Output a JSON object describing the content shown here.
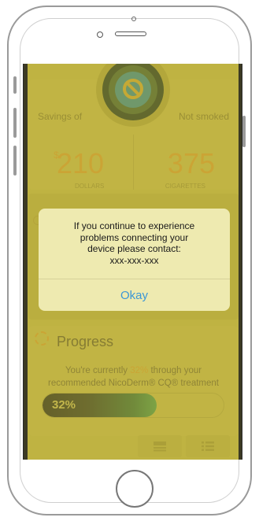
{
  "stats": {
    "savings_label": "Savings of",
    "not_smoked_label": "Not smoked",
    "currency_symbol": "$",
    "dollars_value": "210",
    "dollars_unit": "DOLLARS",
    "cigarettes_value": "375",
    "cigarettes_unit": "CIGARETTES"
  },
  "alert": {
    "line1": "If you continue to experience",
    "line2": "problems connecting your",
    "line3": "device please contact:",
    "line4": "xxx-xxx-xxx",
    "button_label": "Okay"
  },
  "progress": {
    "title": "Progress",
    "desc_prefix": "You're currently ",
    "percent_text": "32%",
    "desc_suffix_line1": " through your",
    "desc_line2": "recommended NicoDerm® CQ® treatment",
    "bar_label": "32%",
    "fraction": 0.32
  },
  "colors": {
    "accent_orange": "#d9a233",
    "link_blue": "#3c97d6",
    "screen_bg": "#c6b847"
  },
  "icons": {
    "logo": "no-smoking-logo-icon",
    "progress": "progress-ring-icon",
    "tab_a": "list-view-icon",
    "tab_b": "bulleted-list-icon"
  }
}
